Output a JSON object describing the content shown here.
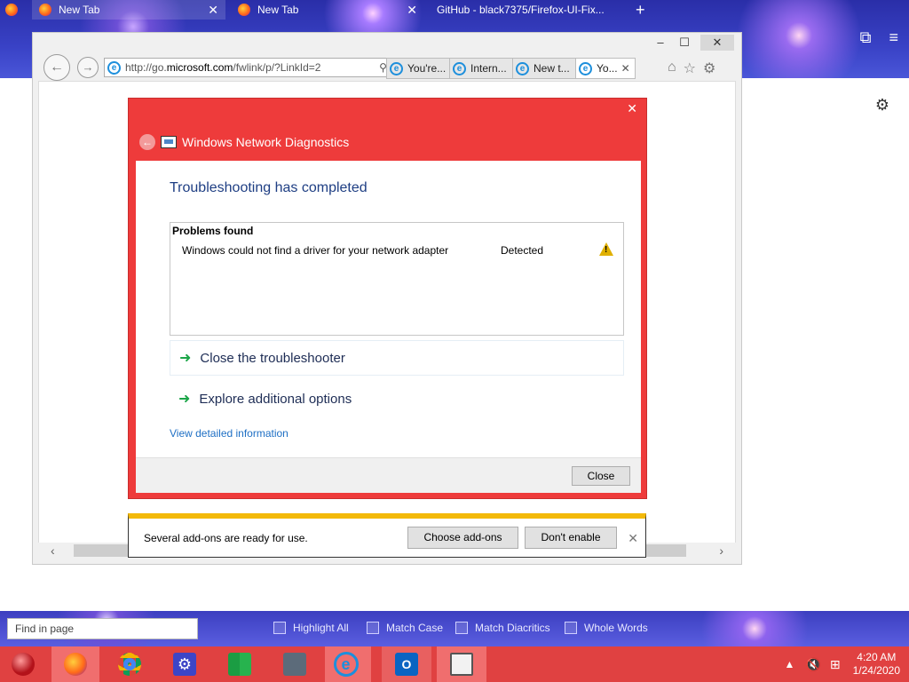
{
  "firefox": {
    "tabs": [
      {
        "label": "New Tab"
      },
      {
        "label": "New Tab"
      },
      {
        "label": "GitHub - black7375/Firefox-UI-Fix..."
      }
    ],
    "new_tab": "+",
    "close": "✕",
    "settings_icon": "gear-icon"
  },
  "ie": {
    "url_prefix": "http://go.",
    "url_domain": "microsoft.com",
    "url_suffix": "/fwlink/p/?LinkId=2",
    "tabs": [
      {
        "label": "You're..."
      },
      {
        "label": "Intern..."
      },
      {
        "label": "New t..."
      },
      {
        "label": "Yo..."
      }
    ],
    "tab_close": "✕"
  },
  "dialog": {
    "title": "Windows Network Diagnostics",
    "heading": "Troubleshooting has completed",
    "problems_header": "Problems found",
    "problems": [
      {
        "text": "Windows could not find a driver for your network adapter",
        "status": "Detected"
      }
    ],
    "actions": [
      {
        "label": "Close the troubleshooter"
      },
      {
        "label": "Explore additional options"
      }
    ],
    "detail_link": "View detailed information",
    "close_button": "Close",
    "close_x": "✕"
  },
  "addon_bar": {
    "message": "Several add-ons are ready for use.",
    "choose_button": "Choose add-ons",
    "dont_enable_button": "Don't enable",
    "close": "✕"
  },
  "findbar": {
    "placeholder": "Find in page",
    "options": [
      "Highlight All",
      "Match Case",
      "Match Diacritics",
      "Whole Words"
    ]
  },
  "taskbar": {
    "time": "4:20 AM",
    "date": "1/24/2020"
  },
  "colors": {
    "dialog_red": "#ee3b3b",
    "taskbar_red": "#e04141",
    "heading_blue": "#1e3e83",
    "link_blue": "#1e6fc4",
    "arrow_green": "#1ba548",
    "warning_yellow": "#e0b000"
  }
}
